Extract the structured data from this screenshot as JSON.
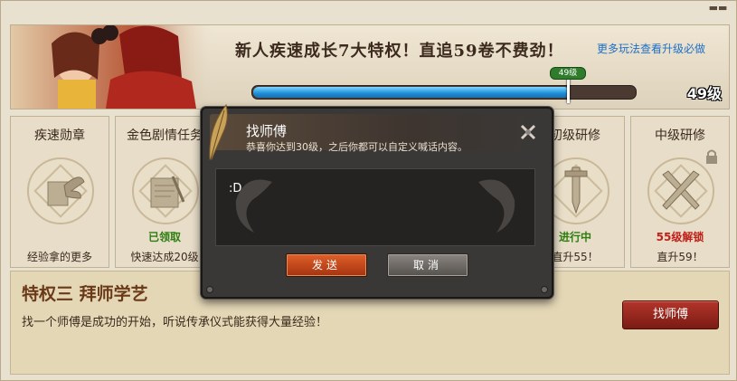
{
  "banner": {
    "headline": "新人疾速成长7大特权！直追59卷不费劲！",
    "more_link": "更多玩法查看升级必做",
    "level_badge": "49级",
    "level_text": "49级",
    "progress": 0.83
  },
  "cards": [
    {
      "title": "疾速勋章",
      "status": "",
      "desc": "经验拿的更多",
      "icon": "winged-scroll-icon"
    },
    {
      "title": "金色剧情任务",
      "status": "已领取",
      "desc": "快速达成20级",
      "icon": "scroll-icon"
    },
    {
      "title": "初级研修",
      "status": "进行中",
      "desc": "直升55！",
      "icon": "sword-icon"
    },
    {
      "title": "中级研修",
      "status": "55级解锁",
      "desc": "直升59！",
      "icon": "crossed-swords-icon"
    }
  ],
  "colors": {
    "status_claimed": "#2e7d10",
    "status_progress": "#2e7d10",
    "status_locked": "#c0201a"
  },
  "bottom": {
    "title": "特权三  拜师学艺",
    "desc": "找一个师傅是成功的开始，听说传承仪式能获得大量经验！",
    "button": "找师傅"
  },
  "dialog": {
    "title": "找师傅",
    "subtitle": "恭喜你达到30级，之后你都可以自定义喊话内容。",
    "message": ":D",
    "send": "发送",
    "cancel": "取消"
  }
}
